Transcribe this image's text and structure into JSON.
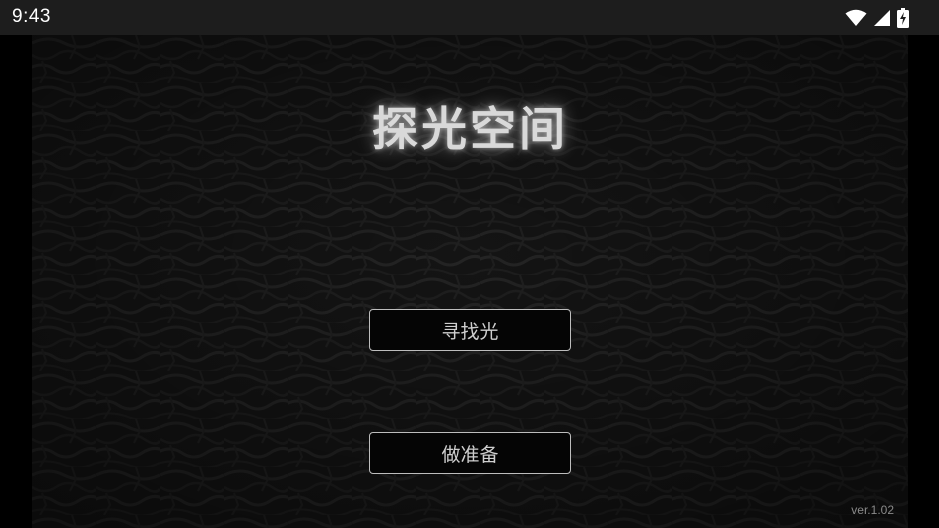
{
  "status_bar": {
    "time": "9:43",
    "icons": [
      "wifi-icon",
      "cellular-signal-icon",
      "battery-charging-icon"
    ]
  },
  "game": {
    "title": "探光空间",
    "buttons": {
      "find_light": "寻找光",
      "prepare": "做准备"
    },
    "version": "ver.1.02"
  },
  "colors": {
    "background": "#141414",
    "title": "#d9d9d9",
    "button_border": "#bdbdbd",
    "button_text": "#cfcfcf",
    "status_bar": "#1d1d1d"
  }
}
